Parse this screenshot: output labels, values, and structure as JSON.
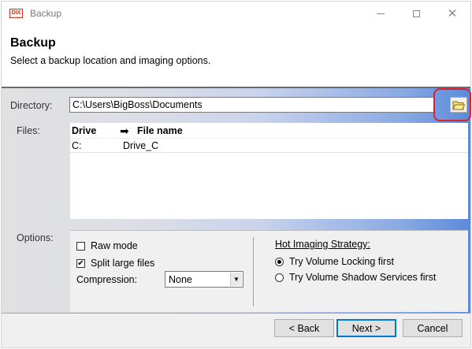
{
  "window": {
    "title": "Backup",
    "app_icon_text": "DIX"
  },
  "header": {
    "title": "Backup",
    "subtitle": "Select a backup location and imaging options."
  },
  "directory": {
    "label": "Directory:",
    "value": "C:\\Users\\BigBoss\\Documents"
  },
  "files": {
    "label": "Files:",
    "columns": [
      "Drive",
      "File name"
    ],
    "rows": [
      {
        "drive": "C:",
        "file": "Drive_C"
      }
    ]
  },
  "options": {
    "label": "Options:",
    "raw_mode": {
      "label": "Raw mode",
      "checked": false
    },
    "split_large_files": {
      "label": "Split large files",
      "checked": true
    },
    "compression": {
      "label": "Compression:",
      "selected": "None"
    },
    "hot_imaging": {
      "title": "Hot Imaging Strategy:",
      "options": [
        {
          "label": "Try Volume Locking first",
          "selected": true
        },
        {
          "label": "Try Volume Shadow Services first",
          "selected": false
        }
      ]
    }
  },
  "buttons": {
    "back": "< Back",
    "next": "Next >",
    "cancel": "Cancel"
  },
  "colors": {
    "highlight": "#d9242f",
    "gradient_end": "#5c8ad9"
  }
}
